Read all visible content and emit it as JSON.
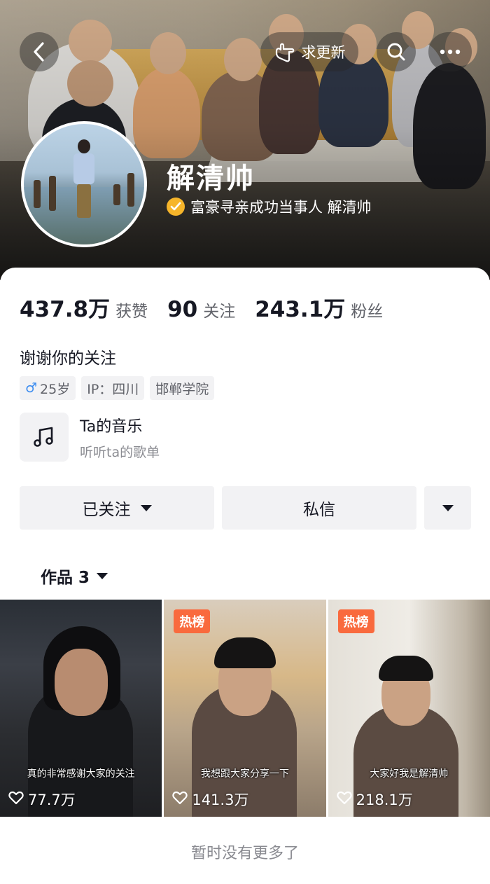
{
  "header": {
    "update_label": "求更新",
    "icons": [
      "back-arrow-icon",
      "update-hand-icon",
      "search-icon",
      "more-icon"
    ]
  },
  "profile": {
    "name": "解清帅",
    "verification": "富豪寻亲成功当事人 解清帅",
    "verify_color": "#f6b52a"
  },
  "stats": [
    {
      "value": "437.8万",
      "label": "获赞"
    },
    {
      "value": "90",
      "label": "关注"
    },
    {
      "value": "243.1万",
      "label": "粉丝"
    }
  ],
  "bio": "谢谢你的关注",
  "tags": {
    "gender_symbol": "♂",
    "age": "25岁",
    "ip": "IP：四川",
    "school": "邯郸学院"
  },
  "music": {
    "title": "Ta的音乐",
    "subtitle": "听听ta的歌单"
  },
  "actions": {
    "follow_label": "已关注",
    "message_label": "私信"
  },
  "works_tab": {
    "label": "作品 3"
  },
  "videos": [
    {
      "caption": "真的非常感谢大家的关注",
      "likes": "77.7万",
      "badge": ""
    },
    {
      "caption": "我想跟大家分享一下",
      "likes": "141.3万",
      "badge": "热榜"
    },
    {
      "caption": "大家好我是解清帅",
      "likes": "218.1万",
      "badge": "热榜"
    }
  ],
  "footer": {
    "no_more": "暂时没有更多了"
  },
  "colors": {
    "hot_badge": "#f96a3e",
    "male_symbol": "#3b8cf0"
  }
}
